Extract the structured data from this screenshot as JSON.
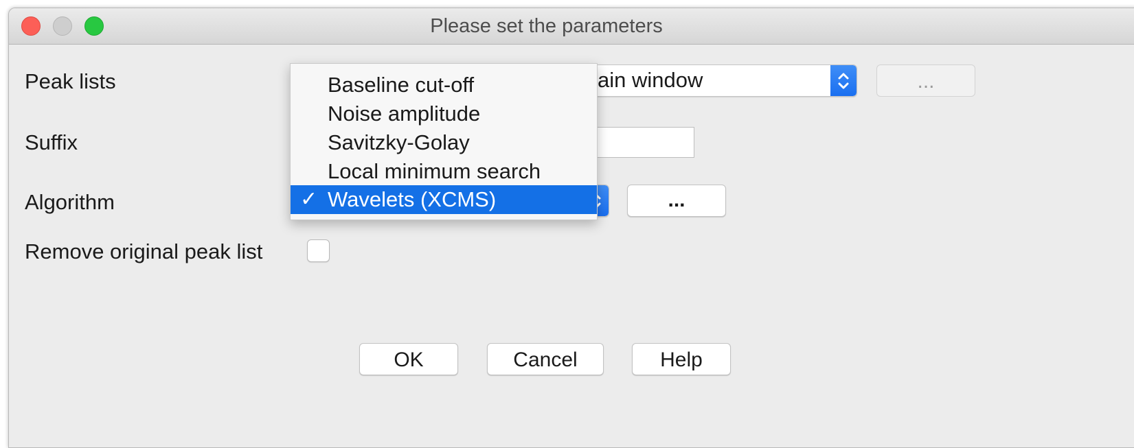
{
  "window": {
    "title": "Please set the parameters"
  },
  "form": {
    "peak_lists_label": "Peak lists",
    "peak_lists_value": "ain window",
    "peak_lists_button": "...",
    "suffix_label": "Suffix",
    "algorithm_label": "Algorithm",
    "algorithm_button": "...",
    "remove_label": "Remove original peak list"
  },
  "algorithm_menu": {
    "items": [
      "Baseline cut-off",
      "Noise amplitude",
      "Savitzky-Golay",
      "Local minimum search",
      "Wavelets (XCMS)"
    ],
    "selected_index": 4,
    "check_glyph": "✓"
  },
  "buttons": {
    "ok": "OK",
    "cancel": "Cancel",
    "help": "Help"
  },
  "colors": {
    "accent": "#1470e6",
    "close": "#fc5f57",
    "zoom": "#28c841"
  }
}
